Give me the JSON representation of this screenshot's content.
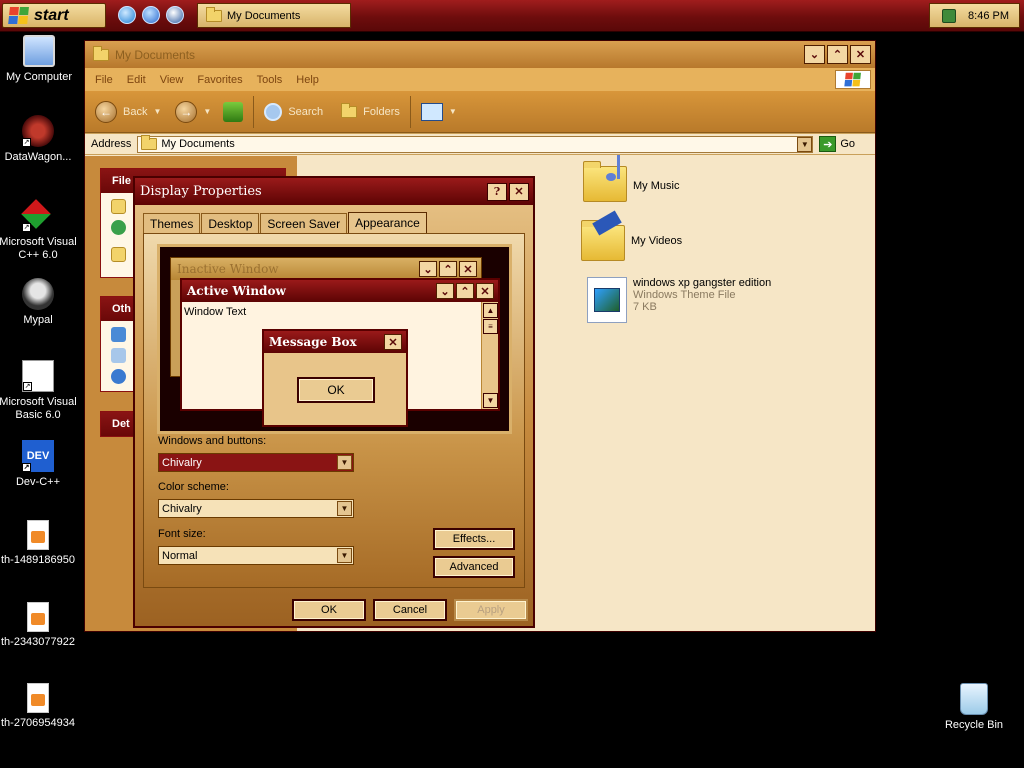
{
  "taskbar": {
    "start_label": "start",
    "task_mydocs": "My Documents",
    "clock": "8:46 PM",
    "quicklaunch": [
      "internet-explorer-icon",
      "outlook-express-icon",
      "media-player-icon"
    ]
  },
  "desktop_icons": [
    {
      "label": "My Computer"
    },
    {
      "label": "DataWagon..."
    },
    {
      "label": "Microsoft Visual C++ 6.0"
    },
    {
      "label": "Mypal"
    },
    {
      "label": "Microsoft Visual Basic 6.0"
    },
    {
      "label": "Dev-C++",
      "badge": "DEV"
    },
    {
      "label": "th-1489186950"
    },
    {
      "label": "th-2343077922"
    },
    {
      "label": "th-2706954934"
    },
    {
      "label": "Recycle Bin"
    }
  ],
  "explorer": {
    "title": "My Documents",
    "menu": [
      "File",
      "Edit",
      "View",
      "Favorites",
      "Tools",
      "Help"
    ],
    "toolbar": {
      "back": "Back",
      "search": "Search",
      "folders": "Folders"
    },
    "address_label": "Address",
    "address_value": "My Documents",
    "go_label": "Go",
    "taskpane": {
      "file_head": "File",
      "other_head": "Oth",
      "details_head": "Det"
    },
    "items": [
      {
        "name": "My Music"
      },
      {
        "name": "My Videos"
      },
      {
        "name": "windows xp gangster edition",
        "type": "Windows Theme File",
        "size": "7 KB"
      }
    ]
  },
  "dialog": {
    "title": "Display Properties",
    "help_btn": "?",
    "close_btn": "✕",
    "tabs": [
      "Themes",
      "Desktop",
      "Screen Saver",
      "Appearance"
    ],
    "active_tab": "Appearance",
    "preview": {
      "inactive_title": "Inactive Window",
      "active_title": "Active Window",
      "window_text": "Window Text",
      "msgbox_title": "Message Box",
      "msgbox_ok": "OK"
    },
    "windows_buttons_label": "Windows and buttons:",
    "windows_buttons_value": "Chivalry",
    "color_scheme_label": "Color scheme:",
    "color_scheme_value": "Chivalry",
    "font_size_label": "Font size:",
    "font_size_value": "Normal",
    "effects_btn": "Effects...",
    "advanced_btn": "Advanced",
    "ok_btn": "OK",
    "cancel_btn": "Cancel",
    "apply_btn": "Apply"
  },
  "colors": {
    "taskbar_red": "#7a1010",
    "accent_gold": "#e7b25c",
    "title_red": "#8a1414"
  }
}
